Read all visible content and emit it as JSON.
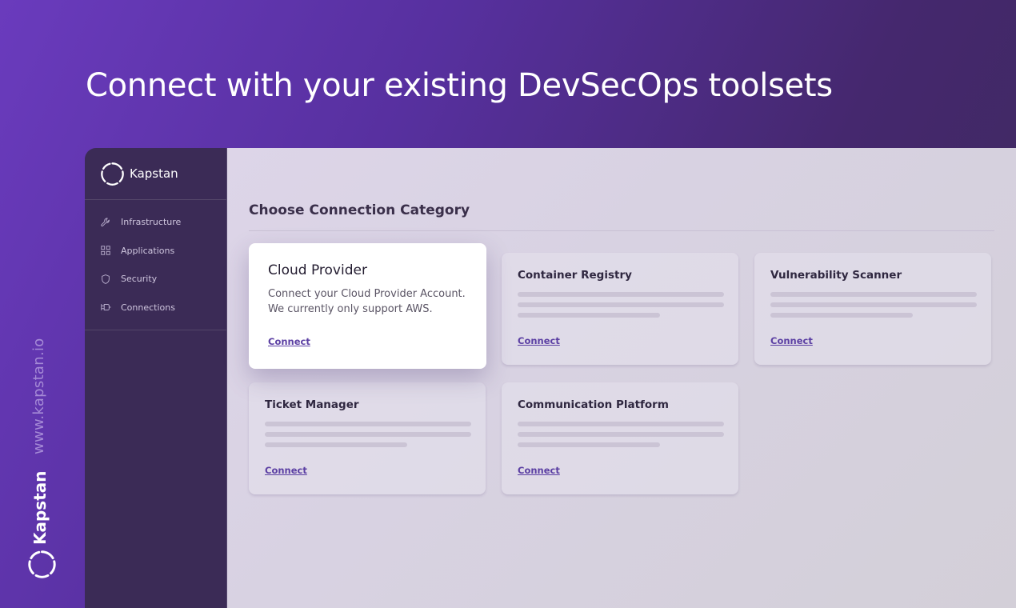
{
  "headline": "Connect with your existing DevSecOps toolsets",
  "side": {
    "url": "www.kapstan.io",
    "brand": "Kapstan"
  },
  "app": {
    "brand": "Kapstan",
    "nav": [
      {
        "label": "Infrastructure",
        "icon": "wrench-icon"
      },
      {
        "label": "Applications",
        "icon": "grid-icon"
      },
      {
        "label": "Security",
        "icon": "shield-icon"
      },
      {
        "label": "Connections",
        "icon": "plug-icon"
      }
    ],
    "section_title": "Choose Connection Category",
    "cards": [
      {
        "title": "Cloud Provider",
        "description": "Connect your Cloud Provider Account. We currently only support AWS.",
        "link": "Connect",
        "active": true
      },
      {
        "title": "Container Registry",
        "link": "Connect"
      },
      {
        "title": "Vulnerability Scanner",
        "link": "Connect"
      },
      {
        "title": "Ticket Manager",
        "link": "Connect"
      },
      {
        "title": "Communication Platform",
        "link": "Connect"
      }
    ]
  },
  "colors": {
    "accent": "#5b3fa3",
    "sidebar": "#3b2b56",
    "background": "#6a3bbd"
  }
}
